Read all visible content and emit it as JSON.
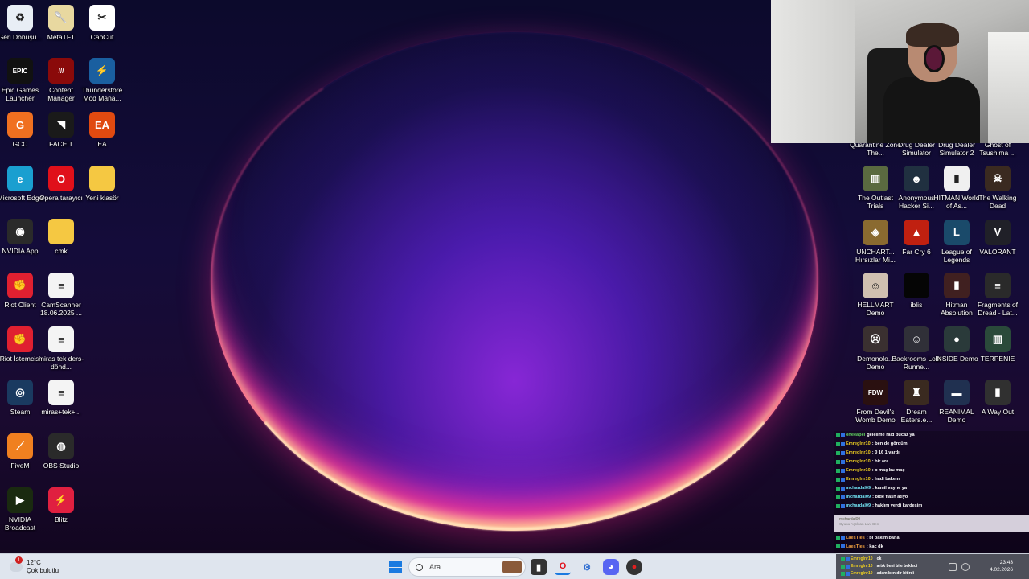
{
  "desktop_left": [
    {
      "label": "Geri Dönüşü...",
      "icon": "recycle-bin-icon",
      "color": "#e8eef5",
      "glyph": "♻"
    },
    {
      "label": "MetaTFT",
      "icon": "metatft-icon",
      "color": "#e8d8a0",
      "glyph": "🥄"
    },
    {
      "label": "CapCut",
      "icon": "capcut-icon",
      "color": "#ffffff",
      "glyph": "✂"
    },
    {
      "label": "Epic Games Launcher",
      "icon": "epic-games-icon",
      "color": "#111111",
      "glyph": "EPIC"
    },
    {
      "label": "Content Manager",
      "icon": "content-manager-icon",
      "color": "#8a0a0a",
      "glyph": "///"
    },
    {
      "label": "Thunderstore Mod Mana...",
      "icon": "thunderstore-icon",
      "color": "#1a5fa0",
      "glyph": "⚡"
    },
    {
      "label": "GCC",
      "icon": "gcc-icon",
      "color": "#f07020",
      "glyph": "G"
    },
    {
      "label": "FACEIT",
      "icon": "faceit-icon",
      "color": "#1a1a1a",
      "glyph": "◥"
    },
    {
      "label": "EA",
      "icon": "ea-icon",
      "color": "#e04a10",
      "glyph": "EA"
    },
    {
      "label": "Microsoft Edge",
      "icon": "edge-icon",
      "color": "#1a9fd0",
      "glyph": "e"
    },
    {
      "label": "Opera tarayıcı",
      "icon": "opera-icon",
      "color": "#e0101a",
      "glyph": "O"
    },
    {
      "label": "Yeni klasör",
      "icon": "folder-icon",
      "color": "#f5c842",
      "glyph": ""
    },
    {
      "label": "NVIDIA App",
      "icon": "nvidia-app-icon",
      "color": "#2a2a2a",
      "glyph": "◉"
    },
    {
      "label": "cmk",
      "icon": "folder-icon",
      "color": "#f5c842",
      "glyph": ""
    },
    {
      "label": "Riot Client",
      "icon": "riot-client-icon",
      "color": "#e02030",
      "glyph": "✊"
    },
    {
      "label": "CamScanner 18.06.2025 ...",
      "icon": "document-icon",
      "color": "#f4f4f4",
      "glyph": "≡"
    },
    {
      "label": "Riot İstemcisi",
      "icon": "riot-client-icon",
      "color": "#e02030",
      "glyph": "✊"
    },
    {
      "label": "miras tek ders-dönd...",
      "icon": "document-icon",
      "color": "#f4f4f4",
      "glyph": "≡"
    },
    {
      "label": "Steam",
      "icon": "steam-icon",
      "color": "#1a3a60",
      "glyph": "◎"
    },
    {
      "label": "miras+tek+...",
      "icon": "document-icon",
      "color": "#f4f4f4",
      "glyph": "≡"
    },
    {
      "label": "FiveM",
      "icon": "fivem-icon",
      "color": "#f08020",
      "glyph": "⟋"
    },
    {
      "label": "OBS Studio",
      "icon": "obs-icon",
      "color": "#2a2a2a",
      "glyph": "◍"
    },
    {
      "label": "NVIDIA Broadcast",
      "icon": "nvidia-broadcast-icon",
      "color": "#1a2a10",
      "glyph": "▶"
    },
    {
      "label": "Blitz",
      "icon": "blitz-icon",
      "color": "#e02040",
      "glyph": "⚡"
    }
  ],
  "desktop_right": [
    {
      "label": "Quarantine Zone The...",
      "icon": "game-icon",
      "color": "#3a3a30",
      "glyph": ""
    },
    {
      "label": "Drug Dealer Simulator",
      "icon": "game-icon",
      "color": "#3a3030",
      "glyph": ""
    },
    {
      "label": "Drug Dealer Simulator 2",
      "icon": "game-icon",
      "color": "#303040",
      "glyph": ""
    },
    {
      "label": "Ghost of Tsushima ...",
      "icon": "game-icon",
      "color": "#402020",
      "glyph": ""
    },
    {
      "label": "The Outlast Trials",
      "icon": "game-icon",
      "color": "#5a6a40",
      "glyph": "▥"
    },
    {
      "label": "Anonymous Hacker Si...",
      "icon": "game-icon",
      "color": "#203040",
      "glyph": "☻"
    },
    {
      "label": "HITMAN World of As...",
      "icon": "game-icon",
      "color": "#f0f0f0",
      "glyph": "▮"
    },
    {
      "label": "The Walking Dead",
      "icon": "game-icon",
      "color": "#3a2a20",
      "glyph": "☠"
    },
    {
      "label": "UNCHART... Hırsızlar Mi...",
      "icon": "game-icon",
      "color": "#8a6a30",
      "glyph": "◈"
    },
    {
      "label": "Far Cry 6",
      "icon": "game-icon",
      "color": "#c02010",
      "glyph": "▲"
    },
    {
      "label": "League of Legends",
      "icon": "game-icon",
      "color": "#1a4a6a",
      "glyph": "L"
    },
    {
      "label": "VALORANT",
      "icon": "game-icon",
      "color": "#202028",
      "glyph": "V"
    },
    {
      "label": "HELLMART Demo",
      "icon": "game-icon",
      "color": "#d0c0b0",
      "glyph": "☺"
    },
    {
      "label": "iblis",
      "icon": "game-icon",
      "color": "#050505",
      "glyph": ""
    },
    {
      "label": "Hitman Absolution",
      "icon": "game-icon",
      "color": "#402020",
      "glyph": "▮"
    },
    {
      "label": "Fragments of Dread - Lat...",
      "icon": "game-icon",
      "color": "#2a2a2a",
      "glyph": "≡"
    },
    {
      "label": "Demonolo... Demo",
      "icon": "game-icon",
      "color": "#3a3030",
      "glyph": "☹"
    },
    {
      "label": "Backrooms Lost Runne...",
      "icon": "game-icon",
      "color": "#303038",
      "glyph": "☺"
    },
    {
      "label": "INSIDE Demo",
      "icon": "game-icon",
      "color": "#2a3a3a",
      "glyph": "●"
    },
    {
      "label": "TERPENIE",
      "icon": "game-icon",
      "color": "#2a4a3a",
      "glyph": "▥"
    },
    {
      "label": "From Devil's Womb Demo",
      "icon": "game-icon",
      "color": "#2a1010",
      "glyph": "FDW"
    },
    {
      "label": "Dream Eaters.e...",
      "icon": "game-icon",
      "color": "#3a2a20",
      "glyph": "♜"
    },
    {
      "label": "REANIMAL Demo",
      "icon": "game-icon",
      "color": "#203050",
      "glyph": "▬"
    },
    {
      "label": "A Way Out",
      "icon": "game-icon",
      "color": "#303030",
      "glyph": "▮"
    }
  ],
  "chat": {
    "lines": [
      {
        "user": "oneeapel",
        "message": "gelelime raid bucaz ya",
        "color": "#60d060"
      },
      {
        "user": "Emreglnr10",
        "message": ": ben de gördüm",
        "color": "#f0d020"
      },
      {
        "user": "Emreglnr10",
        "message": ": 0 16 1 vardı",
        "color": "#f0d020"
      },
      {
        "user": "Emreglnr10",
        "message": ": bir ara",
        "color": "#f0d020"
      },
      {
        "user": "Emreglnr10",
        "message": ": o maç bu maç",
        "color": "#f0d020"
      },
      {
        "user": "Emreglnr10",
        "message": ": hadi bakem",
        "color": "#f0d020"
      },
      {
        "user": "mchardal09",
        "message": ": kamil vayne ya",
        "color": "#70e0f0"
      },
      {
        "user": "mchardal09",
        "message": ": bide flash atıyo",
        "color": "#70e0f0"
      },
      {
        "user": "mchardal09",
        "message": ": haklını verdi kardeşim",
        "color": "#70e0f0"
      }
    ],
    "input_user": "mchardal09",
    "input_sub": "Oyunu Açtıktan Lwu Beni",
    "lines_after": [
      {
        "user": "LaesTies",
        "message": ": bi bakım bana",
        "color": "#f0a040"
      },
      {
        "user": "LaesTies",
        "message": ": kaç dk",
        "color": "#f0a040"
      }
    ],
    "tray_lines": [
      {
        "user": "Emreglnr10",
        "message": ": ok",
        "color": "#f0d020"
      },
      {
        "user": "Emreglnr10",
        "message": ": artık beni bile bekledi",
        "color": "#f0d020"
      },
      {
        "user": "Emreglnr10",
        "message": ": adam benidir bitirdi",
        "color": "#f0d020"
      }
    ]
  },
  "taskbar": {
    "weather_temp": "12°C",
    "weather_desc": "Çok bulutlu",
    "weather_badge": "1",
    "search_placeholder": "Ara",
    "clock_time": "23:43",
    "clock_date": "4.02.2026"
  }
}
